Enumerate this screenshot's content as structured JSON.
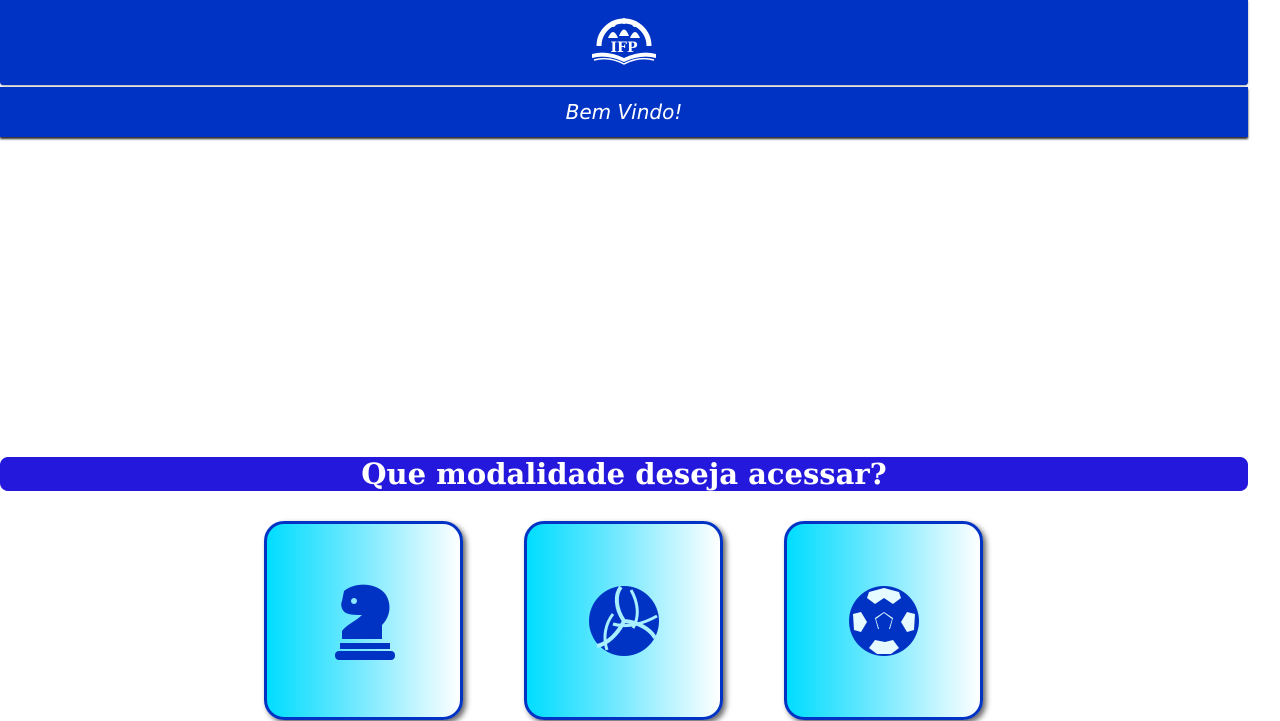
{
  "header": {
    "logo_icon": "ifp-logo",
    "logo_text": "IFP",
    "welcome": "Bem Vindo!"
  },
  "main": {
    "question": "Que modalidade deseja acessar?",
    "modalities": [
      {
        "icon": "chess-knight-icon"
      },
      {
        "icon": "volleyball-icon"
      },
      {
        "icon": "soccer-ball-icon"
      }
    ]
  },
  "colors": {
    "header_blue": "#0033c4",
    "question_bar": "#2418dc",
    "card_gradient_start": "#00ddff",
    "card_gradient_end": "#ffffff",
    "icon_color": "#0033c4"
  }
}
